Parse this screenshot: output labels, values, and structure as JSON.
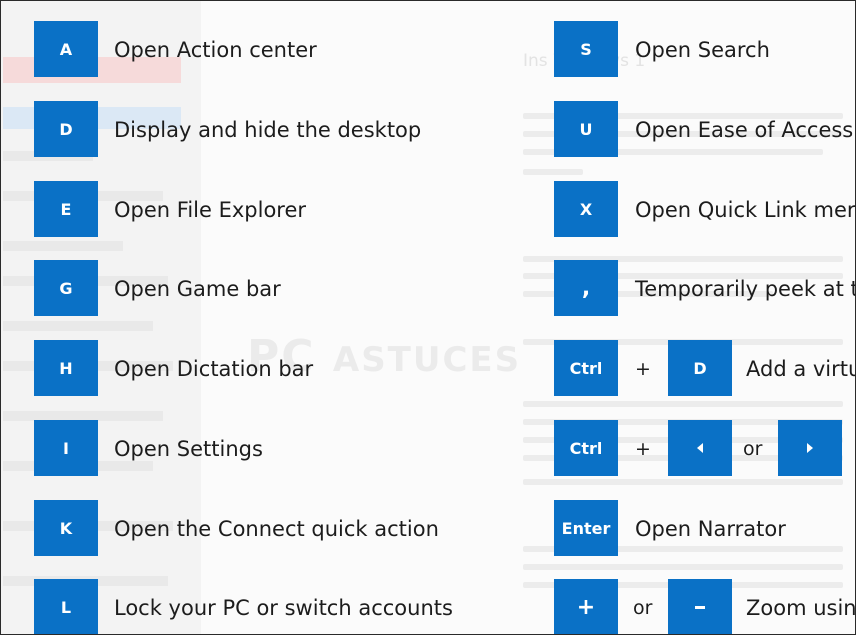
{
  "colors": {
    "key_background": "#0a71c6",
    "key_text": "#ffffff",
    "label_text": "#1c1c1c"
  },
  "left_column": [
    {
      "key": "A",
      "label": "Open Action center"
    },
    {
      "key": "D",
      "label": "Display and hide the desktop"
    },
    {
      "key": "E",
      "label": "Open File Explorer"
    },
    {
      "key": "G",
      "label": "Open Game bar"
    },
    {
      "key": "H",
      "label": "Open Dictation bar"
    },
    {
      "key": "I",
      "label": "Open Settings"
    },
    {
      "key": "K",
      "label": "Open the Connect quick action"
    },
    {
      "key": "L",
      "label": "Lock your PC or switch accounts"
    }
  ],
  "right_column": [
    {
      "key": "S",
      "label": "Open Search"
    },
    {
      "key": "U",
      "label": "Open Ease of Access"
    },
    {
      "key": "X",
      "label": "Open Quick Link mer"
    },
    {
      "key": ",",
      "label": "Temporarily peek at t"
    },
    {
      "key": "Ctrl",
      "plus": "+",
      "key2": "D",
      "label": "Add a virtu"
    },
    {
      "key": "Ctrl",
      "plus": "+",
      "key2_icon": "arrow-left-icon",
      "or": "or",
      "key3_icon": "arrow-right-icon"
    },
    {
      "key": "Enter",
      "label": "Open Narrator"
    },
    {
      "key_icon": "plus-icon",
      "or": "or",
      "key2_icon": "minus-icon",
      "label": "Zoom usin"
    }
  ],
  "watermark": {
    "text_big": "PC",
    "text_small": "ASTUCES"
  },
  "background_title": "Ins                    Windows 1"
}
